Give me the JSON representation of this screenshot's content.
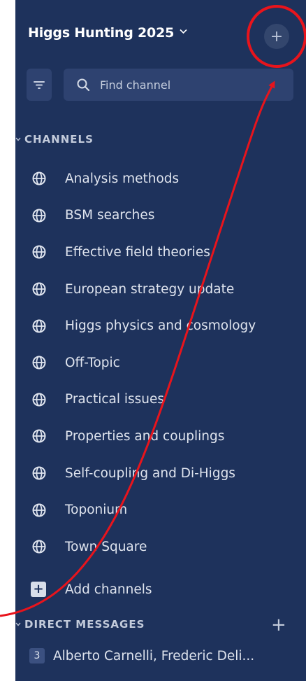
{
  "team": {
    "name": "Higgs Hunting 2025",
    "chevron_icon": "chevron-down-icon",
    "add_label": "+"
  },
  "search": {
    "placeholder": "Find channel"
  },
  "sections": {
    "channels_label": "CHANNELS",
    "dm_label": "DIRECT MESSAGES",
    "dm_add_label": "+"
  },
  "channels": [
    {
      "label": "Analysis methods",
      "icon": "globe-icon"
    },
    {
      "label": "BSM searches",
      "icon": "globe-icon"
    },
    {
      "label": "Effective field theories",
      "icon": "globe-icon"
    },
    {
      "label": "European strategy update",
      "icon": "globe-icon"
    },
    {
      "label": "Higgs physics and cosmology",
      "icon": "globe-icon"
    },
    {
      "label": "Off-Topic",
      "icon": "globe-icon"
    },
    {
      "label": "Practical issues",
      "icon": "globe-icon"
    },
    {
      "label": "Properties and couplings",
      "icon": "globe-icon"
    },
    {
      "label": "Self-coupling and Di-Higgs",
      "icon": "globe-icon"
    },
    {
      "label": "Toponium",
      "icon": "globe-icon"
    },
    {
      "label": "Town Square",
      "icon": "globe-icon"
    }
  ],
  "add_channels": {
    "label": "Add channels",
    "icon_text": "+"
  },
  "direct_messages": [
    {
      "count": "3",
      "label": "Alberto Carnelli, Frederic Deli..."
    }
  ],
  "colors": {
    "sidebar_bg": "#1e325c",
    "annotation_red": "#e8141c"
  }
}
